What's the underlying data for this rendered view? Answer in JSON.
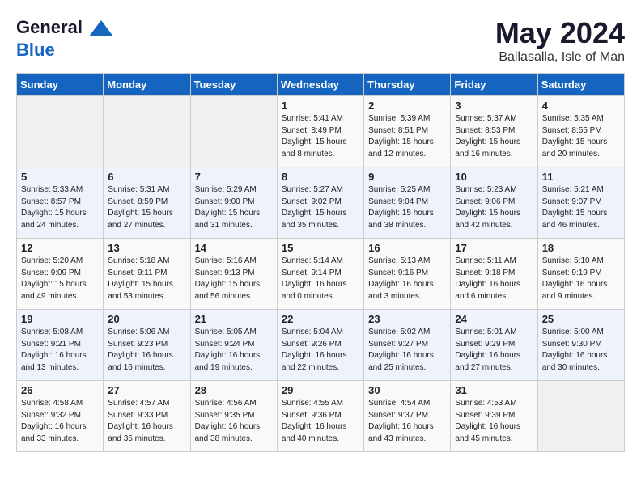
{
  "header": {
    "logo_line1": "General",
    "logo_line2": "Blue",
    "month": "May 2024",
    "location": "Ballasalla, Isle of Man"
  },
  "days_of_week": [
    "Sunday",
    "Monday",
    "Tuesday",
    "Wednesday",
    "Thursday",
    "Friday",
    "Saturday"
  ],
  "weeks": [
    [
      {
        "day": "",
        "sunrise": "",
        "sunset": "",
        "daylight": ""
      },
      {
        "day": "",
        "sunrise": "",
        "sunset": "",
        "daylight": ""
      },
      {
        "day": "",
        "sunrise": "",
        "sunset": "",
        "daylight": ""
      },
      {
        "day": "1",
        "sunrise": "5:41 AM",
        "sunset": "8:49 PM",
        "daylight": "15 hours and 8 minutes."
      },
      {
        "day": "2",
        "sunrise": "5:39 AM",
        "sunset": "8:51 PM",
        "daylight": "15 hours and 12 minutes."
      },
      {
        "day": "3",
        "sunrise": "5:37 AM",
        "sunset": "8:53 PM",
        "daylight": "15 hours and 16 minutes."
      },
      {
        "day": "4",
        "sunrise": "5:35 AM",
        "sunset": "8:55 PM",
        "daylight": "15 hours and 20 minutes."
      }
    ],
    [
      {
        "day": "5",
        "sunrise": "5:33 AM",
        "sunset": "8:57 PM",
        "daylight": "15 hours and 24 minutes."
      },
      {
        "day": "6",
        "sunrise": "5:31 AM",
        "sunset": "8:59 PM",
        "daylight": "15 hours and 27 minutes."
      },
      {
        "day": "7",
        "sunrise": "5:29 AM",
        "sunset": "9:00 PM",
        "daylight": "15 hours and 31 minutes."
      },
      {
        "day": "8",
        "sunrise": "5:27 AM",
        "sunset": "9:02 PM",
        "daylight": "15 hours and 35 minutes."
      },
      {
        "day": "9",
        "sunrise": "5:25 AM",
        "sunset": "9:04 PM",
        "daylight": "15 hours and 38 minutes."
      },
      {
        "day": "10",
        "sunrise": "5:23 AM",
        "sunset": "9:06 PM",
        "daylight": "15 hours and 42 minutes."
      },
      {
        "day": "11",
        "sunrise": "5:21 AM",
        "sunset": "9:07 PM",
        "daylight": "15 hours and 46 minutes."
      }
    ],
    [
      {
        "day": "12",
        "sunrise": "5:20 AM",
        "sunset": "9:09 PM",
        "daylight": "15 hours and 49 minutes."
      },
      {
        "day": "13",
        "sunrise": "5:18 AM",
        "sunset": "9:11 PM",
        "daylight": "15 hours and 53 minutes."
      },
      {
        "day": "14",
        "sunrise": "5:16 AM",
        "sunset": "9:13 PM",
        "daylight": "15 hours and 56 minutes."
      },
      {
        "day": "15",
        "sunrise": "5:14 AM",
        "sunset": "9:14 PM",
        "daylight": "16 hours and 0 minutes."
      },
      {
        "day": "16",
        "sunrise": "5:13 AM",
        "sunset": "9:16 PM",
        "daylight": "16 hours and 3 minutes."
      },
      {
        "day": "17",
        "sunrise": "5:11 AM",
        "sunset": "9:18 PM",
        "daylight": "16 hours and 6 minutes."
      },
      {
        "day": "18",
        "sunrise": "5:10 AM",
        "sunset": "9:19 PM",
        "daylight": "16 hours and 9 minutes."
      }
    ],
    [
      {
        "day": "19",
        "sunrise": "5:08 AM",
        "sunset": "9:21 PM",
        "daylight": "16 hours and 13 minutes."
      },
      {
        "day": "20",
        "sunrise": "5:06 AM",
        "sunset": "9:23 PM",
        "daylight": "16 hours and 16 minutes."
      },
      {
        "day": "21",
        "sunrise": "5:05 AM",
        "sunset": "9:24 PM",
        "daylight": "16 hours and 19 minutes."
      },
      {
        "day": "22",
        "sunrise": "5:04 AM",
        "sunset": "9:26 PM",
        "daylight": "16 hours and 22 minutes."
      },
      {
        "day": "23",
        "sunrise": "5:02 AM",
        "sunset": "9:27 PM",
        "daylight": "16 hours and 25 minutes."
      },
      {
        "day": "24",
        "sunrise": "5:01 AM",
        "sunset": "9:29 PM",
        "daylight": "16 hours and 27 minutes."
      },
      {
        "day": "25",
        "sunrise": "5:00 AM",
        "sunset": "9:30 PM",
        "daylight": "16 hours and 30 minutes."
      }
    ],
    [
      {
        "day": "26",
        "sunrise": "4:58 AM",
        "sunset": "9:32 PM",
        "daylight": "16 hours and 33 minutes."
      },
      {
        "day": "27",
        "sunrise": "4:57 AM",
        "sunset": "9:33 PM",
        "daylight": "16 hours and 35 minutes."
      },
      {
        "day": "28",
        "sunrise": "4:56 AM",
        "sunset": "9:35 PM",
        "daylight": "16 hours and 38 minutes."
      },
      {
        "day": "29",
        "sunrise": "4:55 AM",
        "sunset": "9:36 PM",
        "daylight": "16 hours and 40 minutes."
      },
      {
        "day": "30",
        "sunrise": "4:54 AM",
        "sunset": "9:37 PM",
        "daylight": "16 hours and 43 minutes."
      },
      {
        "day": "31",
        "sunrise": "4:53 AM",
        "sunset": "9:39 PM",
        "daylight": "16 hours and 45 minutes."
      },
      {
        "day": "",
        "sunrise": "",
        "sunset": "",
        "daylight": ""
      }
    ]
  ],
  "labels": {
    "sunrise": "Sunrise:",
    "sunset": "Sunset:",
    "daylight": "Daylight:"
  }
}
